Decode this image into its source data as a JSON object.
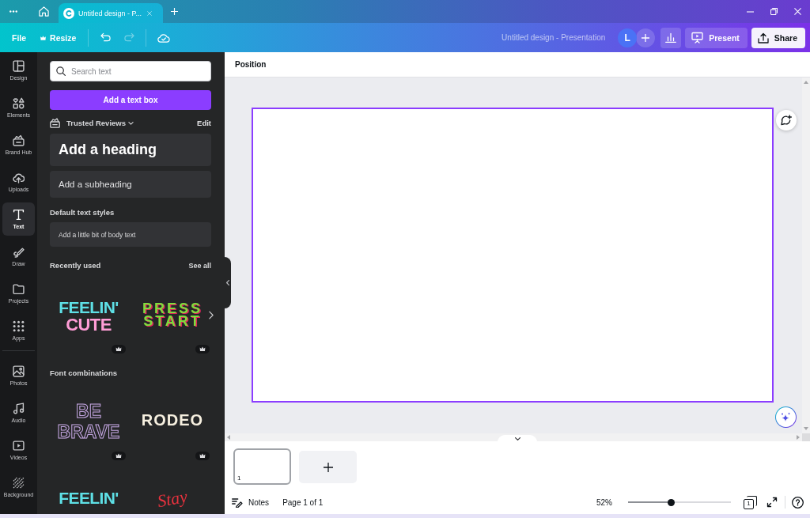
{
  "titlebar": {
    "tabs": [
      {
        "title": "Untitled design - P...",
        "selected": true
      }
    ]
  },
  "toolbar": {
    "menus": [
      {
        "label": "File"
      },
      {
        "label": "Resize",
        "premium": true
      }
    ],
    "history": [
      {
        "kind": "undo",
        "disabled": false
      },
      {
        "kind": "redo",
        "disabled": true
      }
    ],
    "document_title": "Untitled design - Presentation",
    "avatar": "L",
    "present": "Present",
    "share": "Share"
  },
  "sidebar": {
    "sections": [
      {
        "items": [
          {
            "label": "Design",
            "selected": false
          },
          {
            "label": "Elements",
            "selected": false
          },
          {
            "label": "Brand Hub",
            "selected": false
          },
          {
            "label": "Uploads",
            "selected": false
          },
          {
            "label": "Text",
            "selected": true
          },
          {
            "label": "Draw",
            "selected": false
          },
          {
            "label": "Projects",
            "selected": false
          },
          {
            "label": "Apps",
            "selected": false
          }
        ]
      },
      {
        "items": [
          {
            "label": "Photos",
            "selected": false
          },
          {
            "label": "Audio",
            "selected": false
          },
          {
            "label": "Videos",
            "selected": false
          },
          {
            "label": "Background",
            "selected": false
          }
        ]
      }
    ]
  },
  "panel": {
    "search": {
      "placeholder": "Search text"
    },
    "add_button": "Add a text box",
    "brand_kit": {
      "name": "Trusted Reviews",
      "action": "Edit"
    },
    "text_styles": [
      {
        "kind": "heading",
        "text": "Add a heading"
      },
      {
        "kind": "subheading",
        "text": "Add a subheading"
      }
    ],
    "default_styles": {
      "title": "Default text styles",
      "items": [
        {
          "kind": "body",
          "text": "Add a little bit of body text"
        }
      ]
    },
    "recently_used": {
      "title": "Recently used",
      "action": "See all",
      "templates": [
        {
          "kind": "pop",
          "lines": [
            "FEELIN'",
            "CUTE"
          ],
          "premium": true
        },
        {
          "kind": "arcade",
          "lines": [
            "PRESS",
            "START"
          ],
          "premium": true
        }
      ]
    },
    "font_combinations": {
      "title": "Font combinations",
      "templates": [
        {
          "kind": "outline",
          "lines": [
            "BE",
            "BRAVE"
          ],
          "premium": true
        },
        {
          "kind": "western",
          "lines": [
            "RODEO"
          ],
          "premium": true
        },
        {
          "kind": "pop",
          "lines": [
            "FEELIN'"
          ]
        },
        {
          "kind": "script",
          "lines": [
            "Stay"
          ]
        }
      ]
    }
  },
  "canvas": {
    "toolbar_label": "Position",
    "page": {
      "selected": true
    }
  },
  "pages": [
    {
      "number": "1",
      "selected": true
    }
  ],
  "footer": {
    "notes": "Notes",
    "page_indicator": "Page 1 of 1",
    "zoom": {
      "reading": "52%",
      "level": 0.42
    },
    "page_count": "1"
  }
}
